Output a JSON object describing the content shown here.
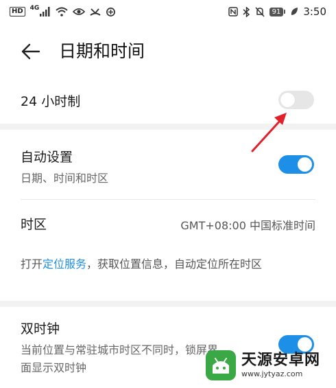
{
  "status_bar": {
    "hd": "HD",
    "network": "4G",
    "battery": "91",
    "time": "3:50"
  },
  "header": {
    "title": "日期和时间",
    "back_icon": "arrow-left-icon"
  },
  "settings": {
    "hour24": {
      "label": "24 小时制",
      "enabled": false
    },
    "auto": {
      "label": "自动设置",
      "sublabel": "日期、时间和时区",
      "enabled": true
    },
    "timezone": {
      "label": "时区",
      "value": "GMT+08:00 中国标准时间"
    },
    "location_hint": {
      "prefix": "打开",
      "link": "定位服务",
      "suffix": "，获取位置信息，自动定位所在时区"
    },
    "dual_clock": {
      "label": "双时钟",
      "sublabel_line1": "当前位置与常驻城市时区不同时，锁屏界",
      "sublabel_line2": "面显示双时钟",
      "enabled": true
    }
  },
  "watermark": {
    "title": "天源安卓网",
    "url": "www.jytyaz.com"
  },
  "colors": {
    "accent": "#1e8fe6",
    "annotation_arrow": "#e0202a",
    "watermark_green": "#3aa845"
  }
}
